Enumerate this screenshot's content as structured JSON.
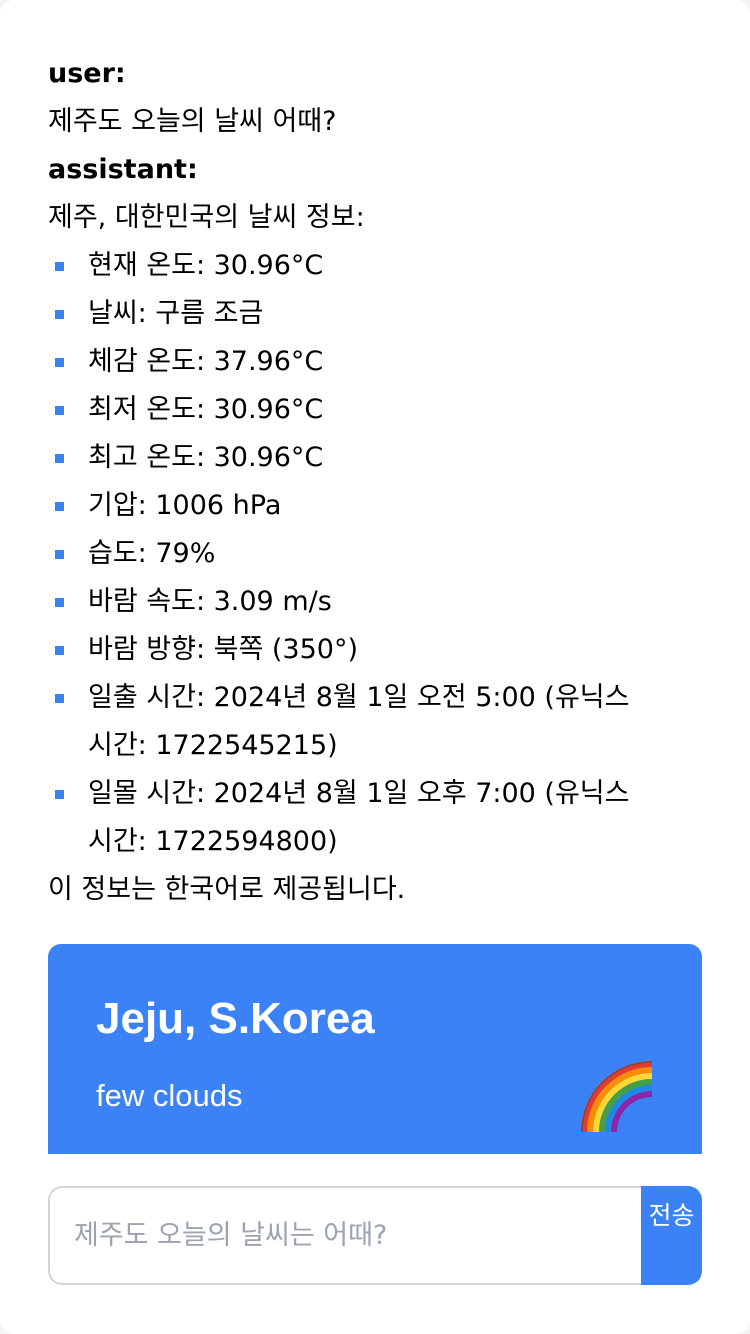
{
  "conversation": {
    "user_label": "user:",
    "user_message": "제주도 오늘의 날씨 어때?",
    "assistant_label": "assistant:",
    "assistant_intro": "제주, 대한민국의 날씨 정보:",
    "weather_items": [
      "현재 온도: 30.96°C",
      "날씨: 구름 조금",
      "체감 온도: 37.96°C",
      "최저 온도: 30.96°C",
      "최고 온도: 30.96°C",
      "기압: 1006 hPa",
      "습도: 79%",
      "바람 속도: 3.09 m/s",
      "바람 방향: 북쪽 (350°)",
      "일출 시간: 2024년 8월 1일 오전 5:00 (유닉스",
      "시간: 1722545215)",
      "일몰 시간: 2024년 8월 1일 오후 7:00 (유닉스",
      "시간: 1722594800)"
    ],
    "assistant_outro": "이 정보는 한국어로 제공됩니다."
  },
  "weather_card": {
    "city": "Jeju, S.Korea",
    "description": "few clouds",
    "icon": "rainbow-icon",
    "background_color": "#3b82f6"
  },
  "composer": {
    "placeholder": "제주도 오늘의 날씨는 어때?",
    "value": "",
    "send_label": "전송"
  },
  "colors": {
    "accent": "#3b82f6",
    "input_border": "#d1d5db",
    "placeholder": "#9ca3af"
  }
}
